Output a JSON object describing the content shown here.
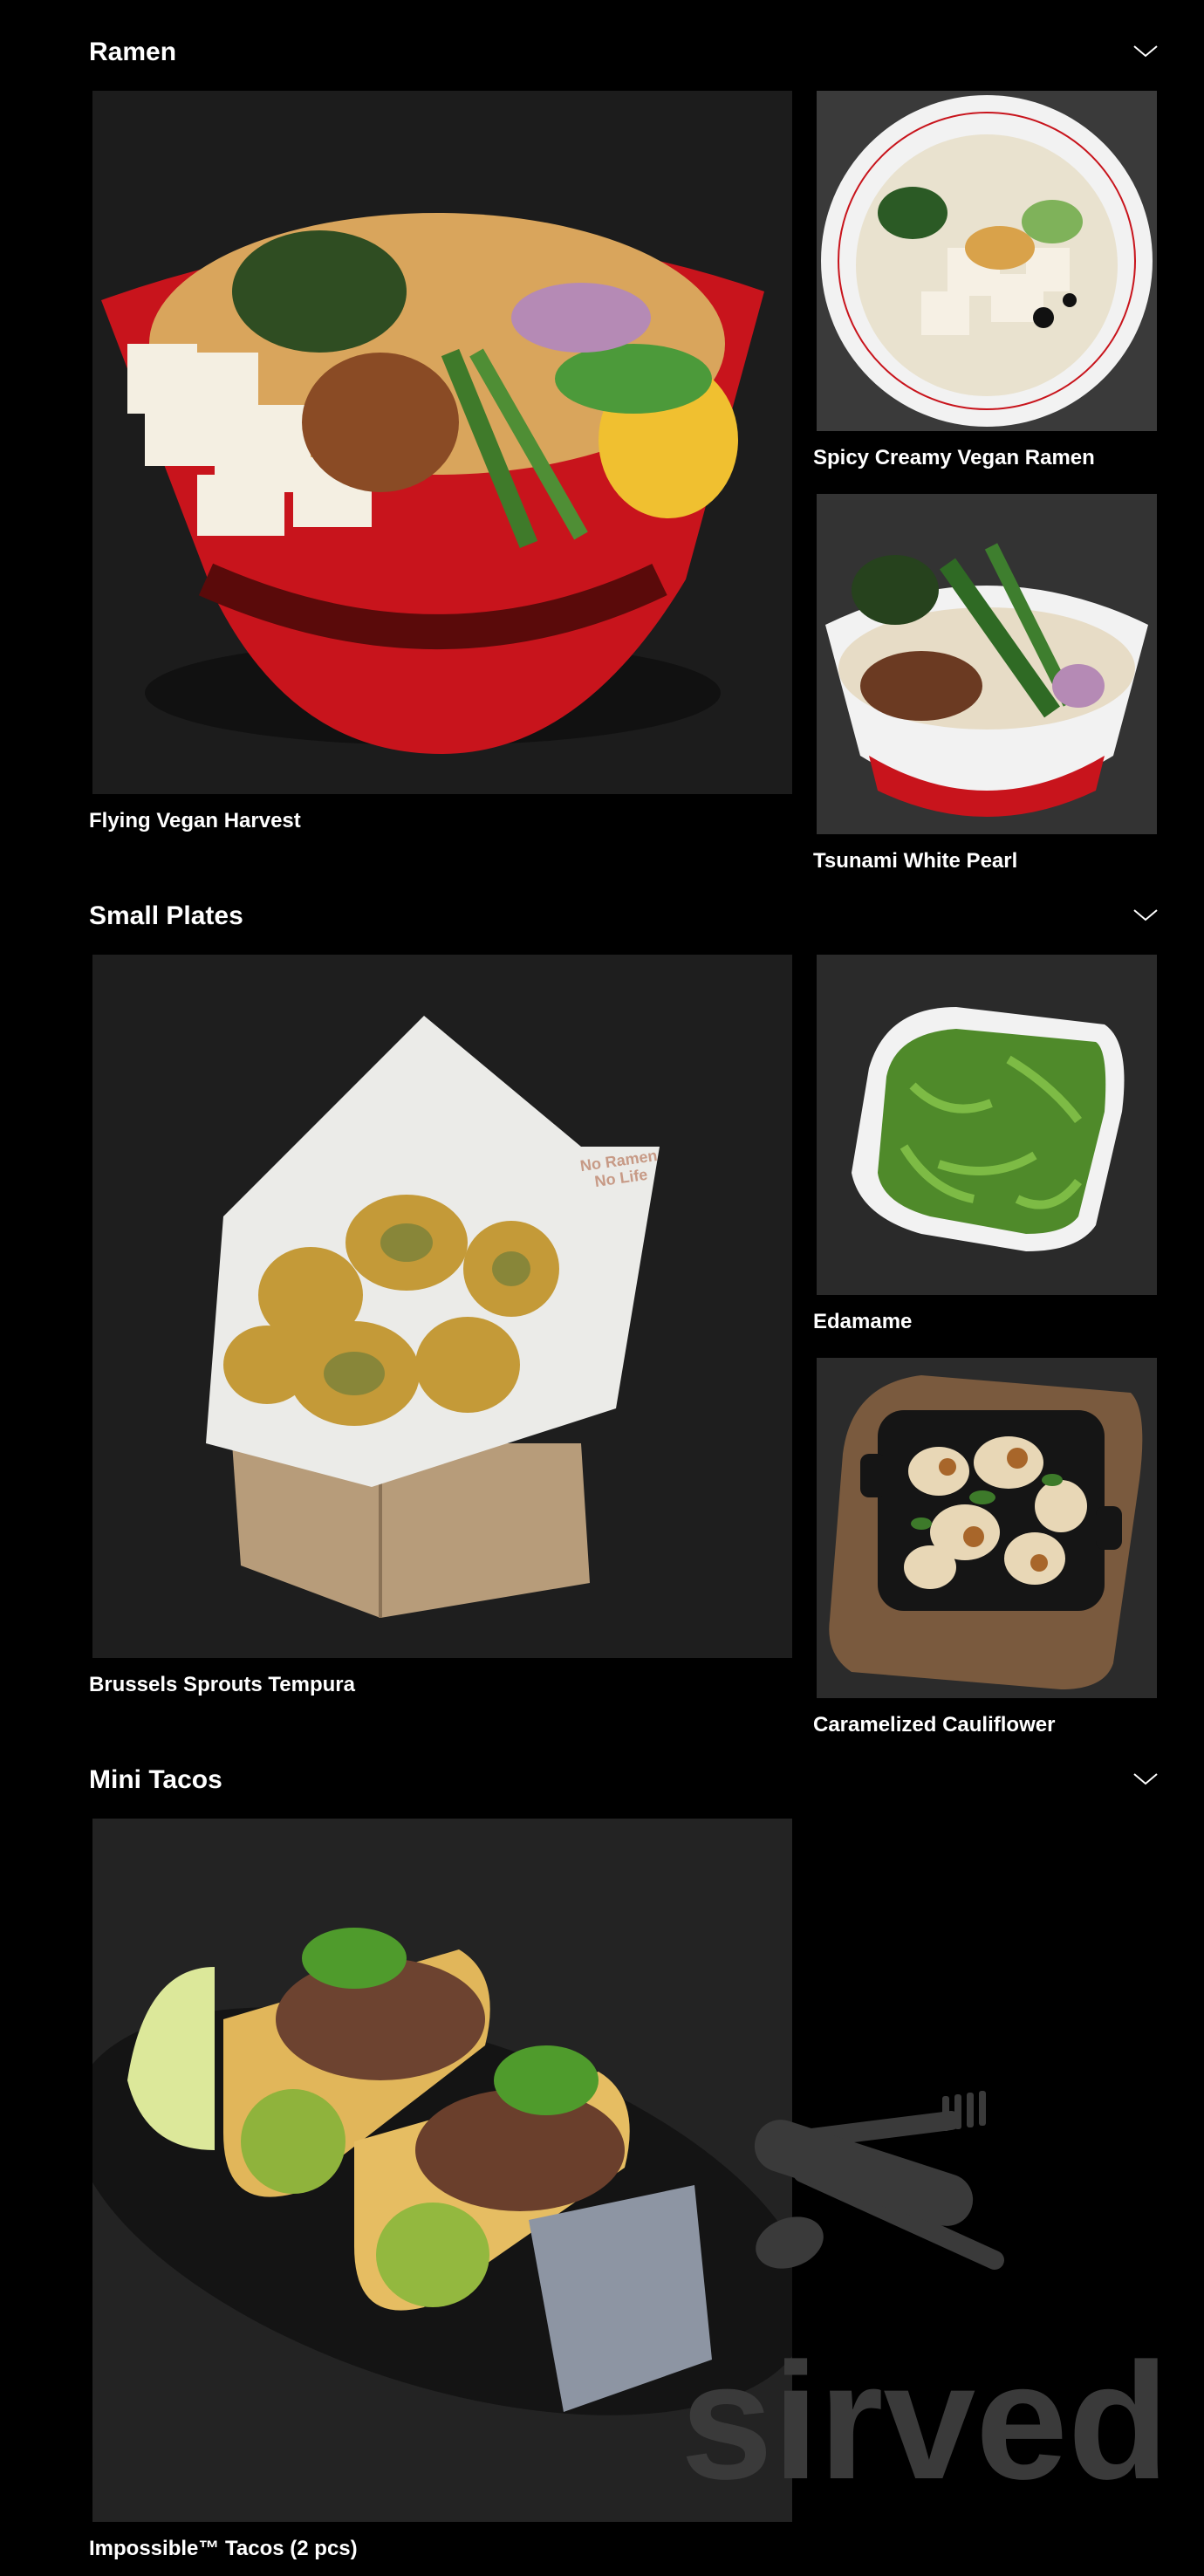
{
  "sections": [
    {
      "title": "Ramen",
      "toggle_icon": "chevron-down-icon",
      "items": [
        {
          "name": "Flying Vegan Harvest",
          "photo": "red bowl ramen with tofu, broccolini, corn, green beans"
        },
        {
          "name": "Spicy Creamy Vegan Ramen",
          "photo": "white bowl creamy ramen with tofu"
        },
        {
          "name": "Tsunami White Pearl",
          "photo": "white bowl ramen with broccolini and patty"
        }
      ]
    },
    {
      "title": "Small Plates",
      "toggle_icon": "chevron-down-icon",
      "items": [
        {
          "name": "Brussels Sprouts Tempura",
          "photo": "tempura in paper-lined wooden box",
          "paper_print": [
            "No Ramen",
            "No Life"
          ]
        },
        {
          "name": "Edamame",
          "photo": "edamame in white square bowl"
        },
        {
          "name": "Caramelized Cauliflower",
          "photo": "cauliflower in cast iron dish on board"
        }
      ]
    },
    {
      "title": "Mini Tacos",
      "toggle_icon": "chevron-down-icon",
      "items": [
        {
          "name": "Impossible™ Tacos (2 pcs)",
          "photo": "two tacos with guacamole and lime on black plate"
        }
      ]
    }
  ],
  "watermark": {
    "text": "sirved",
    "icon": "fork-spoon-icon"
  },
  "colors": {
    "background": "#000000",
    "text": "#ffffff",
    "bowl_red": "#c8141c",
    "watermark": "#3a3a3a"
  }
}
